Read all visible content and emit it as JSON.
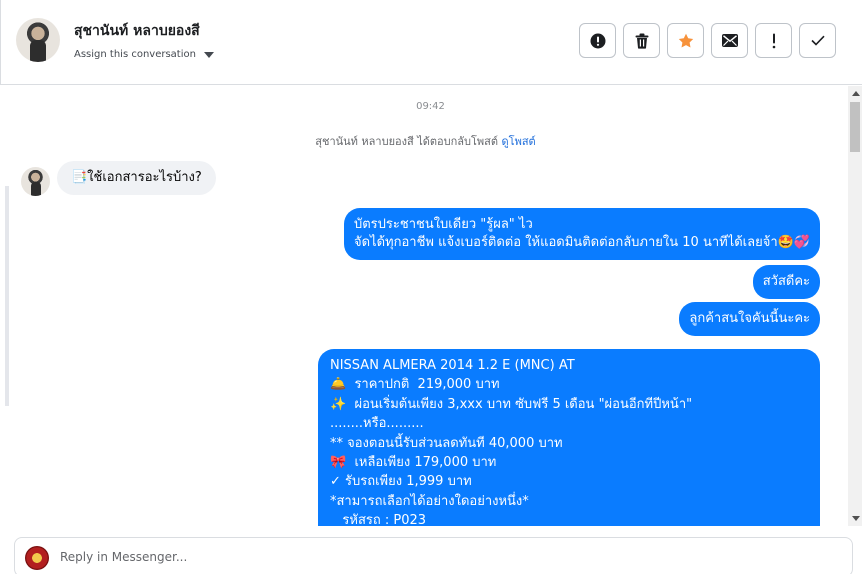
{
  "header": {
    "contact_name": "สุชานันท์ หลาบยองสี",
    "assign_label": "Assign this conversation",
    "actions": [
      {
        "name": "mark-spam-button",
        "icon": "alert-circle-icon"
      },
      {
        "name": "delete-button",
        "icon": "trash-icon"
      },
      {
        "name": "star-button",
        "icon": "star-icon"
      },
      {
        "name": "mark-unread-button",
        "icon": "envelope-icon"
      },
      {
        "name": "follow-up-button",
        "icon": "exclamation-icon"
      },
      {
        "name": "mark-done-button",
        "icon": "check-icon"
      }
    ]
  },
  "chat": {
    "timestamp": "09:42",
    "reply_note": "สุชานันท์ หลาบยองสี ได้ตอบกลับโพสต์",
    "reply_note_link": "ดูโพสต์",
    "incoming": [
      {
        "text": "📑ใช้เอกสารอะไรบ้าง?"
      }
    ],
    "outgoing": [
      {
        "text": "บัตรประชาชนใบเดียว \"รู้ผล\" ไว\nจัดได้ทุกอาชีพ แจ้งเบอร์ติดต่อ ให้แอดมินติดต่อกลับภายใน 10 นาทีได้เลยจ้า🤩💞"
      },
      {
        "text": "สวัสดีคะ"
      },
      {
        "text": "ลูกค้าสนใจคันนี้นะคะ"
      },
      {
        "text": "NISSAN ALMERA 2014 1.2 E (MNC) AT\n🛎️  ราคาปกติ  219,000 บาท\n✨  ผ่อนเริ่มต้นเพียง 3,xxx บาท ซับฟรี 5 เดือน \"ผ่อนอีกทีปีหน้า\"\n........หรือ.........\n** จองตอนนี้รับส่วนลดทันที 40,000 บาท\n🎀  เหลือเพียง 179,000 บาท\n✓ รับรถเพียง 1,999 บาท\n*สามารถเลือกได้อย่างใดอย่างหนึ่ง*\n   รหัสรถ : P023"
      }
    ]
  },
  "composer": {
    "placeholder": "Reply in Messenger..."
  },
  "colors": {
    "accent": "#0a7cff",
    "star": "#f7923b",
    "incoming_bubble": "#f0f2f5"
  }
}
